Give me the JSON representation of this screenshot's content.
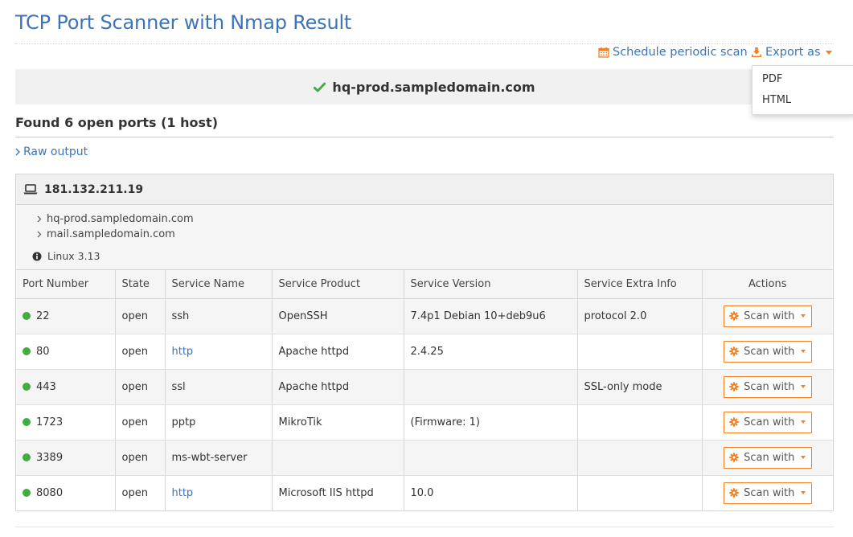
{
  "page": {
    "title": "TCP Port Scanner with Nmap Result"
  },
  "toolbar": {
    "schedule_label": "Schedule periodic scan",
    "export_label": "Export as",
    "export_menu": [
      "PDF",
      "HTML"
    ]
  },
  "target": {
    "hostname": "hq-prod.sampledomain.com"
  },
  "summary": {
    "heading": "Found 6 open ports (1 host)",
    "raw_output_label": "Raw output"
  },
  "host": {
    "ip": "181.132.211.19",
    "hostnames": [
      "hq-prod.sampledomain.com",
      "mail.sampledomain.com"
    ],
    "os": "Linux 3.13"
  },
  "table": {
    "columns": [
      "Port Number",
      "State",
      "Service Name",
      "Service Product",
      "Service Version",
      "Service Extra Info",
      "Actions"
    ],
    "rows": [
      {
        "port": "22",
        "state": "open",
        "service": "ssh",
        "service_link": false,
        "product": "OpenSSH",
        "version": "7.4p1 Debian 10+deb9u6",
        "extra": "protocol 2.0"
      },
      {
        "port": "80",
        "state": "open",
        "service": "http",
        "service_link": true,
        "product": "Apache httpd",
        "version": "2.4.25",
        "extra": ""
      },
      {
        "port": "443",
        "state": "open",
        "service": "ssl",
        "service_link": false,
        "product": "Apache httpd",
        "version": "",
        "extra": "SSL-only mode"
      },
      {
        "port": "1723",
        "state": "open",
        "service": "pptp",
        "service_link": false,
        "product": "MikroTik",
        "version": "(Firmware: 1)",
        "extra": ""
      },
      {
        "port": "3389",
        "state": "open",
        "service": "ms-wbt-server",
        "service_link": false,
        "product": "",
        "version": "",
        "extra": ""
      },
      {
        "port": "8080",
        "state": "open",
        "service": "http",
        "service_link": true,
        "product": "Microsoft IIS httpd",
        "version": "10.0",
        "extra": ""
      }
    ],
    "action_label": "Scan with"
  },
  "colors": {
    "link": "#3d74b8",
    "accent": "#f47e20",
    "status_open": "#3fae3f"
  },
  "icons": {
    "schedule": "calendar-icon",
    "export": "download-icon",
    "target_status": "check-icon",
    "raw_output": "chevron-right-icon",
    "host": "laptop-icon",
    "os": "info-icon",
    "action": "gear-icon"
  }
}
